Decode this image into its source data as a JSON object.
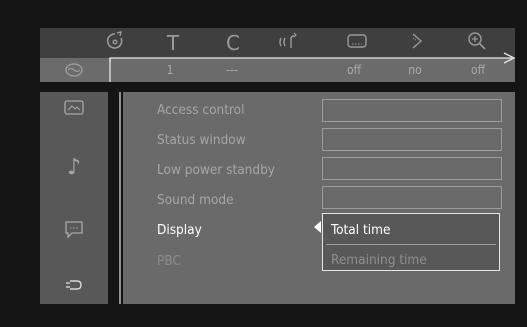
{
  "colors": {
    "background": "#141414",
    "icon_bar": "#3f3f3f",
    "value_row": "#6b6b6b",
    "panel": "#6a6a6a",
    "sidebar": "#585858",
    "text_active": "#ffffff",
    "text_inactive": "#a6a6a6",
    "line": "#e6e6e6"
  },
  "top_icons": [
    {
      "icon": "disc-menu-icon"
    },
    {
      "glyph": "T",
      "icon": "title-icon"
    },
    {
      "glyph": "C",
      "icon": "chapter-icon"
    },
    {
      "icon": "audio-icon"
    },
    {
      "icon": "subtitle-icon"
    },
    {
      "icon": "angle-icon"
    },
    {
      "icon": "zoom-icon"
    }
  ],
  "value_row": {
    "title": "1",
    "chapter": "---",
    "subtitle": "off",
    "angle": "no",
    "zoom": "off"
  },
  "sidebar_icons": [
    {
      "icon": "picture-settings-icon"
    },
    {
      "icon": "sound-settings-icon",
      "glyph": "♪"
    },
    {
      "icon": "language-settings-icon"
    },
    {
      "icon": "features-settings-icon"
    }
  ],
  "menu": [
    {
      "label": "Access control"
    },
    {
      "label": "Status window"
    },
    {
      "label": "Low power standby"
    },
    {
      "label": "Sound mode"
    },
    {
      "label": "Display"
    },
    {
      "label": "PBC"
    }
  ],
  "popup": {
    "options": [
      "Total time",
      "Remaining time"
    ],
    "selected": "Total time"
  }
}
